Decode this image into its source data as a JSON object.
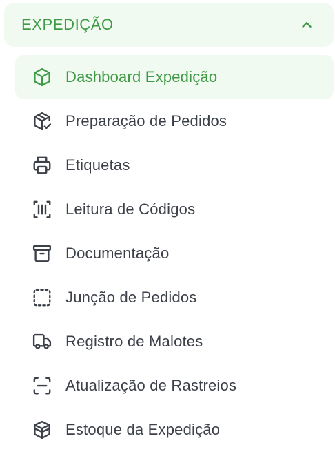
{
  "section": {
    "title": "EXPEDIÇÃO",
    "expanded": true,
    "toggle_icon": "chevron-up-icon"
  },
  "colors": {
    "accent": "#3f9a45",
    "active_bg": "#f1faf1",
    "text": "#3c4049"
  },
  "menu": {
    "items": [
      {
        "label": "Dashboard Expedição",
        "icon": "cube-icon",
        "active": true
      },
      {
        "label": "Preparação de Pedidos",
        "icon": "package-check-icon",
        "active": false
      },
      {
        "label": "Etiquetas",
        "icon": "printer-icon",
        "active": false
      },
      {
        "label": "Leitura de Códigos",
        "icon": "barcode-scan-icon",
        "active": false
      },
      {
        "label": "Documentação",
        "icon": "archive-icon",
        "active": false
      },
      {
        "label": "Junção de Pedidos",
        "icon": "dashed-square-icon",
        "active": false
      },
      {
        "label": "Registro de Malotes",
        "icon": "truck-icon",
        "active": false
      },
      {
        "label": "Atualização de Rastreios",
        "icon": "scan-line-icon",
        "active": false
      },
      {
        "label": "Estoque da Expedição",
        "icon": "boxes-stack-icon",
        "active": false
      }
    ]
  }
}
